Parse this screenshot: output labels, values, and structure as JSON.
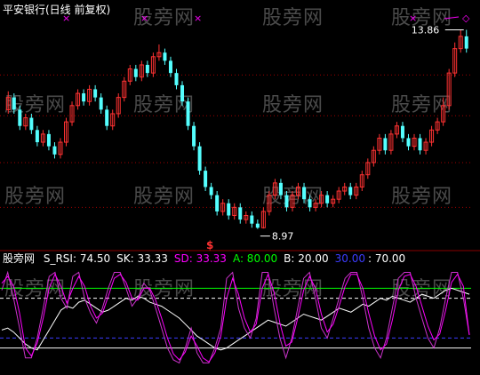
{
  "title": "平安银行(日线 前复权)",
  "watermark": "股旁网",
  "colors": {
    "up": "#ff3232",
    "down": "#54ffff",
    "grid": "#a00000",
    "magenta": "#ff00ff",
    "yellow": "#ffff00",
    "white": "#ffffff",
    "green": "#00ff00",
    "blue": "#3c3cff"
  },
  "price_panel": {
    "high_label": "13.86",
    "low_label": "8.97",
    "signal_symbol": "$",
    "top_markers": [
      "×",
      "×",
      "×",
      "×",
      "◇"
    ]
  },
  "indicator_panel": {
    "name": "股旁网",
    "items": [
      {
        "label": "S_RSI:",
        "value": "74.50",
        "color": "#ffffff"
      },
      {
        "label": "SK:",
        "value": "33.33",
        "color": "#ffffff"
      },
      {
        "label": "SD:",
        "value": "33.33",
        "color": "#ff00ff"
      },
      {
        "label": "A:",
        "value": "80.00",
        "color": "#00ff00"
      },
      {
        "label": "B:",
        "value": "20.00",
        "color": "#ffffff"
      },
      {
        "label": "",
        "value": "30.00",
        "color": "#3c3cff"
      },
      {
        "label": ":",
        "value": "70.00",
        "color": "#ffffff"
      }
    ]
  },
  "chart_data": [
    {
      "type": "candlestick",
      "ylim": [
        8.7,
        14.2
      ],
      "candles": [
        [
          11.9,
          12.2,
          12.35,
          11.8
        ],
        [
          12.2,
          11.9,
          12.3,
          11.8
        ],
        [
          11.9,
          11.5,
          12.0,
          11.4
        ],
        [
          11.5,
          11.7,
          11.8,
          11.4
        ],
        [
          11.7,
          11.4,
          11.8,
          11.3
        ],
        [
          11.4,
          11.1,
          11.5,
          11.0
        ],
        [
          11.1,
          11.3,
          11.4,
          11.0
        ],
        [
          11.3,
          11.0,
          11.4,
          10.9
        ],
        [
          11.0,
          10.8,
          11.1,
          10.7
        ],
        [
          10.8,
          11.1,
          11.2,
          10.7
        ],
        [
          11.1,
          11.6,
          11.7,
          11.0
        ],
        [
          11.6,
          12.0,
          12.1,
          11.5
        ],
        [
          12.0,
          12.3,
          12.4,
          11.9
        ],
        [
          12.3,
          12.1,
          12.4,
          12.0
        ],
        [
          12.1,
          12.4,
          12.5,
          12.0
        ],
        [
          12.4,
          12.2,
          12.5,
          12.1
        ],
        [
          12.2,
          11.9,
          12.3,
          11.8
        ],
        [
          11.9,
          11.5,
          12.0,
          11.4
        ],
        [
          11.5,
          11.8,
          11.9,
          11.4
        ],
        [
          11.8,
          12.2,
          12.3,
          11.7
        ],
        [
          12.2,
          12.6,
          12.7,
          12.1
        ],
        [
          12.6,
          12.9,
          13.0,
          12.5
        ],
        [
          12.9,
          12.7,
          13.0,
          12.6
        ],
        [
          12.7,
          13.0,
          13.1,
          12.6
        ],
        [
          13.0,
          12.8,
          13.1,
          12.7
        ],
        [
          12.8,
          13.2,
          13.3,
          12.7
        ],
        [
          13.2,
          13.3,
          13.5,
          13.1
        ],
        [
          13.3,
          13.1,
          13.4,
          13.0
        ],
        [
          13.1,
          12.8,
          13.2,
          12.7
        ],
        [
          12.8,
          12.5,
          12.9,
          12.4
        ],
        [
          12.5,
          12.1,
          12.6,
          12.0
        ],
        [
          12.1,
          11.5,
          12.2,
          11.4
        ],
        [
          11.5,
          11.0,
          11.6,
          10.9
        ],
        [
          11.0,
          10.4,
          11.1,
          10.3
        ],
        [
          10.4,
          10.0,
          10.5,
          9.9
        ],
        [
          10.0,
          9.8,
          10.1,
          9.7
        ],
        [
          9.8,
          9.4,
          9.9,
          9.3
        ],
        [
          9.4,
          9.6,
          9.7,
          9.3
        ],
        [
          9.6,
          9.3,
          9.7,
          9.2
        ],
        [
          9.3,
          9.5,
          9.6,
          9.2
        ],
        [
          9.5,
          9.2,
          9.6,
          9.1
        ],
        [
          9.2,
          9.3,
          9.4,
          9.1
        ],
        [
          9.3,
          9.1,
          9.4,
          9.0
        ],
        [
          9.1,
          9.0,
          9.2,
          8.97
        ],
        [
          9.0,
          9.4,
          9.5,
          8.98
        ],
        [
          9.4,
          9.8,
          9.9,
          9.3
        ],
        [
          9.8,
          10.1,
          10.2,
          9.7
        ],
        [
          10.1,
          9.8,
          10.2,
          9.7
        ],
        [
          9.8,
          9.5,
          9.9,
          9.4
        ],
        [
          9.5,
          9.8,
          9.9,
          9.4
        ],
        [
          9.8,
          10.0,
          10.1,
          9.7
        ],
        [
          10.0,
          9.7,
          10.1,
          9.6
        ],
        [
          9.7,
          9.5,
          9.8,
          9.4
        ],
        [
          9.5,
          9.6,
          9.7,
          9.4
        ],
        [
          9.6,
          9.8,
          9.9,
          9.5
        ],
        [
          9.8,
          9.6,
          9.9,
          9.5
        ],
        [
          9.6,
          9.7,
          9.8,
          9.5
        ],
        [
          9.7,
          9.9,
          10.0,
          9.6
        ],
        [
          9.9,
          10.0,
          10.1,
          9.8
        ],
        [
          10.0,
          9.8,
          10.1,
          9.7
        ],
        [
          9.8,
          10.0,
          10.1,
          9.7
        ],
        [
          10.0,
          10.3,
          10.4,
          9.9
        ],
        [
          10.3,
          10.6,
          10.7,
          10.2
        ],
        [
          10.6,
          10.9,
          11.0,
          10.5
        ],
        [
          10.9,
          11.2,
          11.3,
          10.8
        ],
        [
          11.2,
          10.9,
          11.3,
          10.8
        ],
        [
          10.9,
          11.3,
          11.4,
          10.8
        ],
        [
          11.3,
          11.5,
          11.6,
          11.2
        ],
        [
          11.5,
          11.2,
          11.6,
          11.1
        ],
        [
          11.2,
          11.0,
          11.3,
          10.9
        ],
        [
          11.0,
          11.2,
          11.3,
          10.9
        ],
        [
          11.2,
          10.9,
          11.3,
          10.8
        ],
        [
          10.9,
          11.1,
          11.2,
          10.8
        ],
        [
          11.1,
          11.4,
          11.5,
          11.0
        ],
        [
          11.4,
          11.6,
          11.7,
          11.3
        ],
        [
          11.6,
          12.0,
          12.2,
          11.5
        ],
        [
          12.0,
          12.8,
          12.9,
          11.9
        ],
        [
          12.8,
          13.4,
          13.55,
          12.7
        ],
        [
          13.4,
          13.7,
          13.86,
          13.3
        ],
        [
          13.7,
          13.4,
          13.86,
          13.3
        ]
      ]
    },
    {
      "type": "line",
      "ylim": [
        0,
        100
      ],
      "reference_lines": {
        "A": 80,
        "B": 20,
        "blue": 30,
        "white_dashed": 70
      },
      "series": [
        {
          "name": "S_RSI",
          "values": [
            38,
            40,
            36,
            30,
            24,
            20,
            18,
            28,
            38,
            48,
            58,
            62,
            60,
            66,
            68,
            64,
            60,
            56,
            58,
            62,
            66,
            70,
            68,
            72,
            70,
            66,
            64,
            62,
            58,
            54,
            50,
            44,
            38,
            32,
            28,
            24,
            20,
            18,
            20,
            24,
            28,
            32,
            36,
            40,
            44,
            48,
            46,
            44,
            42,
            46,
            50,
            54,
            52,
            50,
            48,
            52,
            56,
            60,
            58,
            56,
            60,
            64,
            62,
            66,
            70,
            68,
            72,
            70,
            68,
            66,
            70,
            74,
            72,
            70,
            74,
            78,
            80,
            78,
            76,
            74
          ]
        },
        {
          "name": "SK",
          "values": [
            78,
            96,
            70,
            40,
            10,
            10,
            30,
            60,
            92,
            96,
            70,
            60,
            92,
            96,
            70,
            55,
            45,
            60,
            80,
            96,
            96,
            80,
            62,
            70,
            85,
            78,
            60,
            40,
            20,
            8,
            5,
            20,
            40,
            15,
            5,
            5,
            20,
            40,
            90,
            96,
            60,
            40,
            30,
            50,
            96,
            96,
            60,
            30,
            10,
            30,
            60,
            90,
            96,
            70,
            40,
            30,
            50,
            70,
            90,
            96,
            96,
            70,
            40,
            20,
            10,
            30,
            60,
            90,
            96,
            96,
            70,
            50,
            30,
            20,
            40,
            70,
            96,
            96,
            70,
            33
          ]
        },
        {
          "name": "SD",
          "values": [
            85,
            92,
            82,
            55,
            20,
            12,
            25,
            50,
            80,
            94,
            82,
            65,
            80,
            92,
            82,
            62,
            50,
            55,
            72,
            90,
            94,
            86,
            70,
            68,
            80,
            80,
            68,
            50,
            30,
            14,
            8,
            16,
            32,
            22,
            10,
            6,
            15,
            32,
            70,
            90,
            74,
            50,
            36,
            44,
            80,
            94,
            76,
            45,
            22,
            26,
            50,
            78,
            92,
            80,
            54,
            36,
            44,
            62,
            82,
            94,
            94,
            80,
            55,
            32,
            18,
            24,
            48,
            78,
            92,
            94,
            82,
            62,
            42,
            28,
            34,
            58,
            86,
            94,
            82,
            33
          ]
        }
      ]
    }
  ]
}
